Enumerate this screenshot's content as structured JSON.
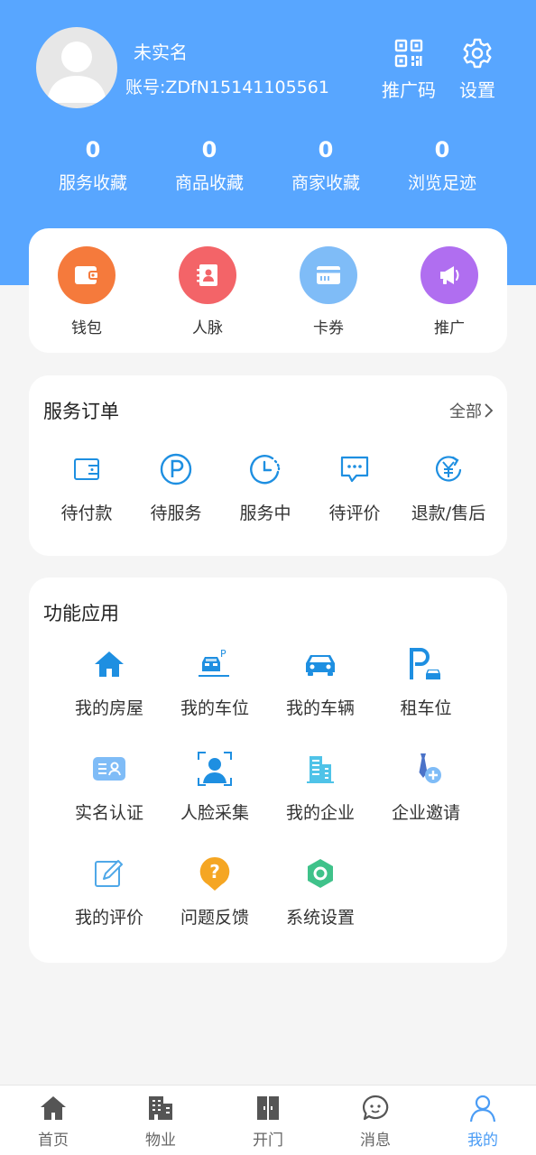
{
  "profile": {
    "name": "未实名",
    "account": "账号:ZDfN15141105561",
    "promo_code_label": "推广码",
    "settings_label": "设置"
  },
  "stats": [
    {
      "value": "0",
      "label": "服务收藏"
    },
    {
      "value": "0",
      "label": "商品收藏"
    },
    {
      "value": "0",
      "label": "商家收藏"
    },
    {
      "value": "0",
      "label": "浏览足迹"
    }
  ],
  "quick_actions": [
    {
      "label": "钱包",
      "icon": "wallet-icon",
      "color": "#f57a3c"
    },
    {
      "label": "人脉",
      "icon": "contacts-icon",
      "color": "#f36468"
    },
    {
      "label": "卡券",
      "icon": "card-icon",
      "color": "#7fbcf7"
    },
    {
      "label": "推广",
      "icon": "megaphone-icon",
      "color": "#b06ef0"
    }
  ],
  "service_orders": {
    "title": "服务订单",
    "all_label": "全部",
    "items": [
      {
        "label": "待付款",
        "icon": "wallet-outline-icon"
      },
      {
        "label": "待服务",
        "icon": "parking-p-icon"
      },
      {
        "label": "服务中",
        "icon": "clock-icon"
      },
      {
        "label": "待评价",
        "icon": "comment-icon"
      },
      {
        "label": "退款/售后",
        "icon": "refund-yen-icon"
      }
    ]
  },
  "functions": {
    "title": "功能应用",
    "items": [
      {
        "label": "我的房屋",
        "icon": "house-icon"
      },
      {
        "label": "我的车位",
        "icon": "parking-spot-icon"
      },
      {
        "label": "我的车辆",
        "icon": "car-icon"
      },
      {
        "label": "租车位",
        "icon": "rent-parking-icon"
      },
      {
        "label": "实名认证",
        "icon": "id-card-icon"
      },
      {
        "label": "人脸采集",
        "icon": "face-scan-icon"
      },
      {
        "label": "我的企业",
        "icon": "building-icon"
      },
      {
        "label": "企业邀请",
        "icon": "invite-icon"
      },
      {
        "label": "我的评价",
        "icon": "edit-icon"
      },
      {
        "label": "问题反馈",
        "icon": "question-icon"
      },
      {
        "label": "系统设置",
        "icon": "hexagon-settings-icon"
      }
    ]
  },
  "tabs": [
    {
      "label": "首页",
      "icon": "home-icon"
    },
    {
      "label": "物业",
      "icon": "property-icon"
    },
    {
      "label": "开门",
      "icon": "door-icon"
    },
    {
      "label": "消息",
      "icon": "message-icon"
    },
    {
      "label": "我的",
      "icon": "user-icon",
      "active": true
    }
  ],
  "colors": {
    "header": "#58a6ff",
    "accent": "#4a9cf5",
    "icon_blue": "#1e8fe1"
  }
}
